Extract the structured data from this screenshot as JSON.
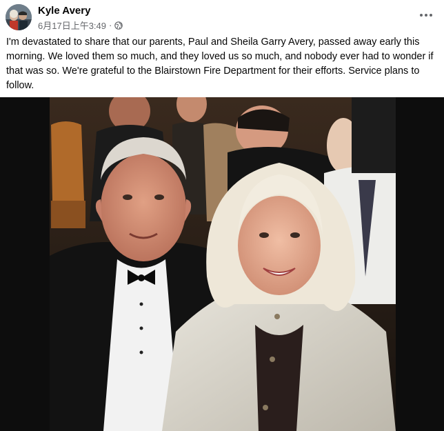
{
  "post": {
    "author": "Kyle Avery",
    "timestamp": "6月17日上午3:49",
    "separator": "·",
    "privacy_icon": "globe-icon",
    "more_icon": "more-options-icon",
    "text": "I'm devastated to share that our parents, Paul and Sheila Garry Avery, passed away early this morning. We loved them so much, and they loved us so much, and nobody ever had to wonder if that was so. We're grateful to the Blairstown Fire Department for their efforts. Service plans to follow."
  },
  "colors": {
    "author_text": "#050505",
    "meta_text": "#65676b",
    "photo_background": "#0d0d0d"
  }
}
